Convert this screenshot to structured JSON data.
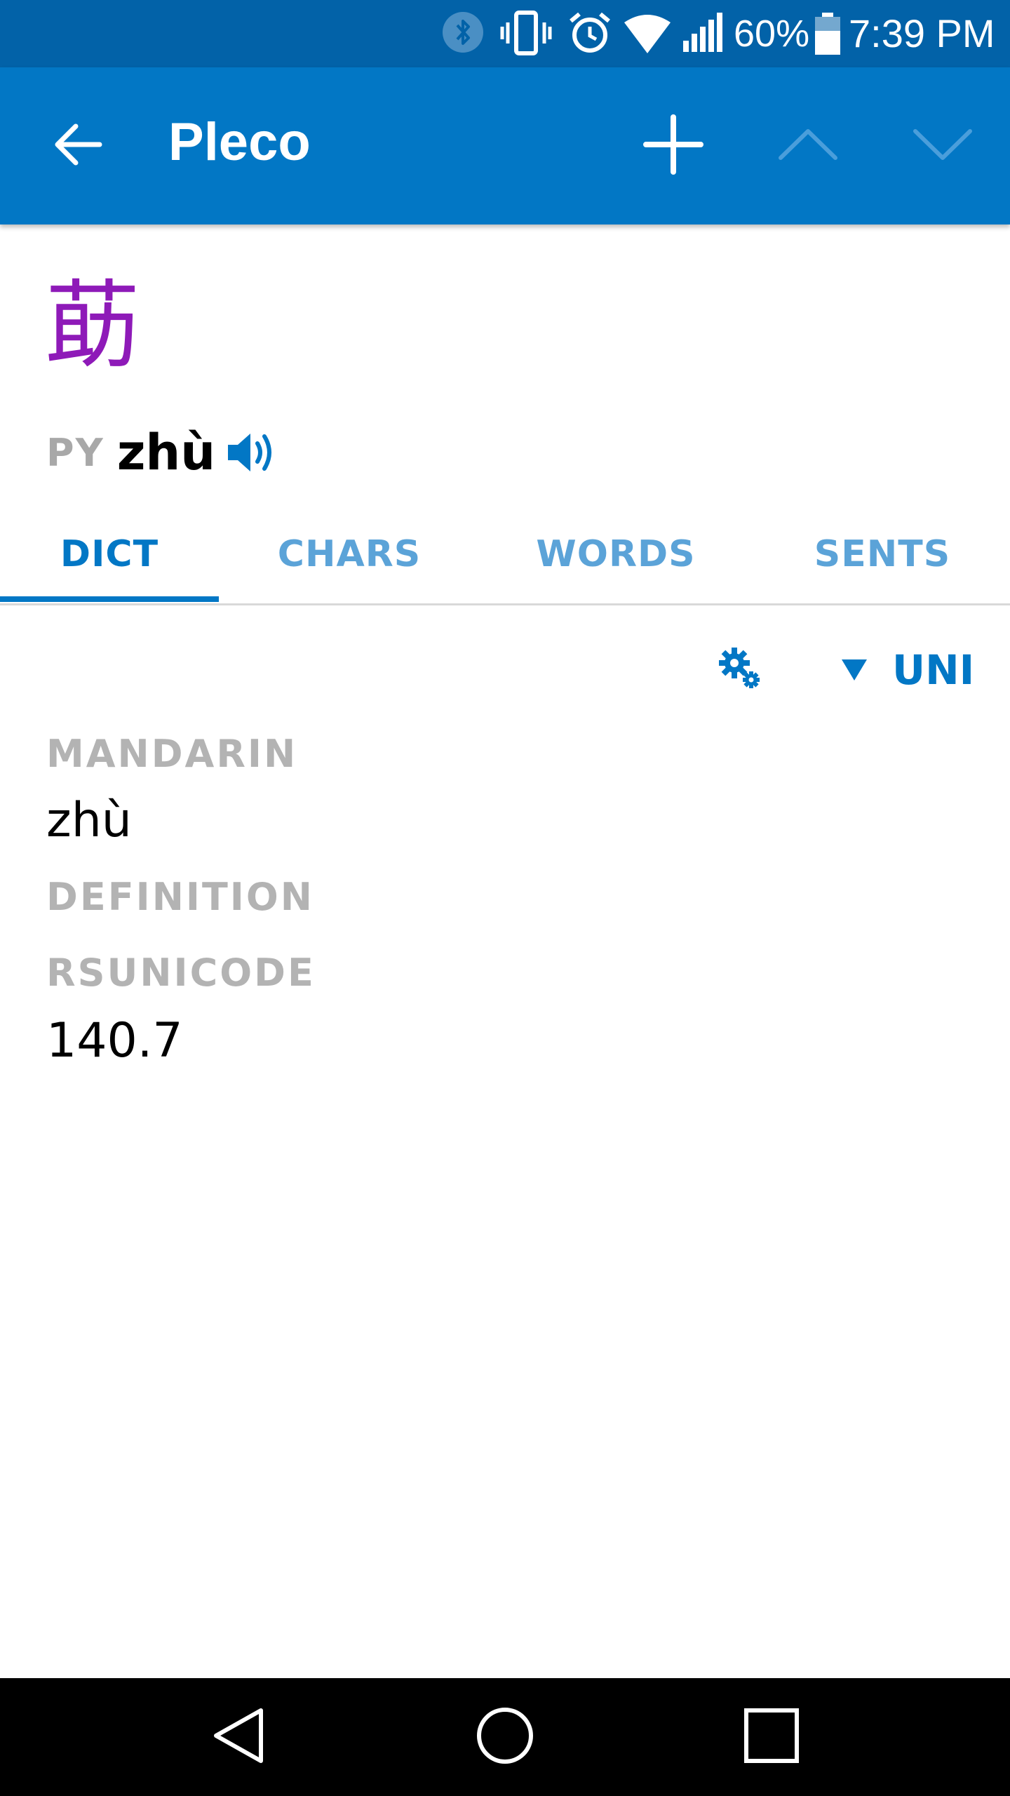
{
  "status_bar": {
    "battery_percent": "60%",
    "time": "7:39 PM",
    "icons": [
      "bluetooth-icon",
      "vibrate-icon",
      "alarm-icon",
      "wifi-icon",
      "signal-icon",
      "battery-icon"
    ]
  },
  "app_bar": {
    "title": "Pleco",
    "back_icon": "arrow-left-icon",
    "add_icon": "plus-icon",
    "up_icon": "chevron-up-icon",
    "down_icon": "chevron-down-icon"
  },
  "header": {
    "character": "莇",
    "py_label": "PY",
    "pinyin": "zhù",
    "speaker_icon": "speaker-icon"
  },
  "tabs": [
    {
      "label": "DICT",
      "active": true
    },
    {
      "label": "CHARS",
      "active": false
    },
    {
      "label": "WORDS",
      "active": false
    },
    {
      "label": "SENTS",
      "active": false
    }
  ],
  "dict_toolbar": {
    "settings_icon": "gears-icon",
    "dictionary_label": "UNI"
  },
  "fields": {
    "mandarin_label": "MANDARIN",
    "mandarin_value": "zhù",
    "definition_label": "DEFINITION",
    "rsunicode_label": "RSUNICODE",
    "rsunicode_value": "140.7"
  },
  "colors": {
    "status_bar": "#0262a8",
    "app_bar": "#0277c5",
    "headword": "#8e1ab8",
    "tab_active": "#0277c5",
    "tab_inactive": "#5ba3d8",
    "label_gray": "#b3b3b3"
  }
}
